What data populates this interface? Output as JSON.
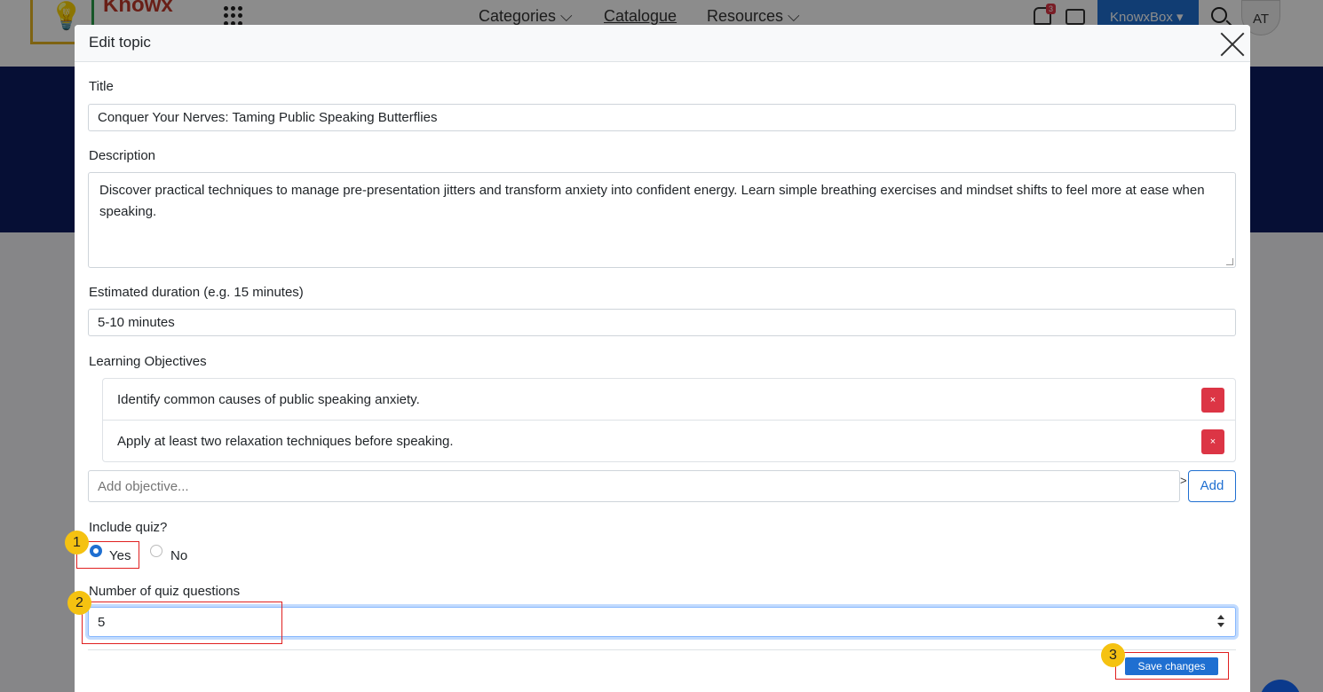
{
  "nav": {
    "logo_text": "Knowx",
    "items": [
      "Categories ⌵",
      "Catalogue",
      "Resources ⌵"
    ],
    "notification_count": "3",
    "account_button": "KnowxBox ▾",
    "avatar_initials": "AT"
  },
  "modal": {
    "title": "Edit topic",
    "title_label": "Title",
    "title_value": "Conquer Your Nerves: Taming Public Speaking Butterflies",
    "description_label": "Description",
    "description_value": "Discover practical techniques to manage pre-presentation jitters and transform anxiety into confident energy. Learn simple breathing exercises and mindset shifts to feel more at ease when speaking.",
    "duration_label": "Estimated duration (e.g. 15 minutes)",
    "duration_value": "5-10 minutes",
    "objectives_label": "Learning Objectives",
    "objectives": [
      {
        "text": "Identify common causes of public speaking anxiety.",
        "delete_label": "×"
      },
      {
        "text": "Apply at least two relaxation techniques before speaking.",
        "delete_label": "×"
      }
    ],
    "add_objective_placeholder": "Add objective...",
    "add_objective_sep": ">",
    "add_button": "Add",
    "quiz_label": "Include quiz?",
    "quiz_options": [
      {
        "label": "Yes",
        "checked": true
      },
      {
        "label": "No",
        "checked": false
      }
    ],
    "quiz_count_label": "Number of quiz questions",
    "quiz_count_value": "5",
    "save_button": "Save changes"
  },
  "annotations": [
    "1",
    "2",
    "3"
  ],
  "colors": {
    "primary": "#1f6fd1",
    "danger": "#dc3545",
    "annotation_marker": "#f5c211",
    "annotation_box": "#e02020",
    "hero": "#0b1c62"
  }
}
